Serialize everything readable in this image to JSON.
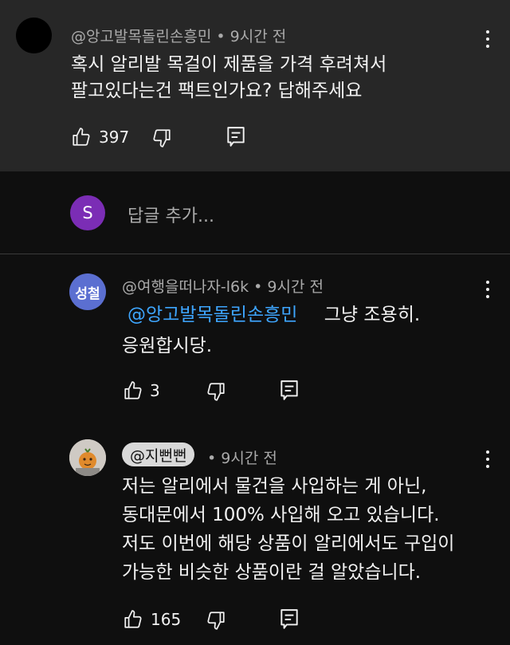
{
  "comment": {
    "author": "@앙고발목돌린손흥민",
    "time": "9시간 전",
    "separator": "•",
    "lines": [
      "혹시 알리발 목걸이 제품을 가격 후려쳐서",
      "팔고있다는건 팩트인가요? 답해주세요"
    ],
    "likes": "397"
  },
  "reply_box": {
    "avatar_letter": "S",
    "placeholder": "답글 추가..."
  },
  "replies": [
    {
      "avatar_text": "성철",
      "author": "@여행을떠나자-l6k",
      "time": "9시간 전",
      "mention": "@앙고발목돌린손흥민",
      "line1_rest": "그냥 조용히.",
      "line2": "응원합시당.",
      "likes": "3"
    },
    {
      "author": "@지뻔뻔",
      "time": "9시간 전",
      "lines": [
        "저는 알리에서 물건을 사입하는 게 아닌,",
        "동대문에서 100% 사입해 오고 있습니다.",
        "저도 이번에 해당 상품이 알리에서도 구입이",
        "가능한 비슷한 상품이란 걸 알았습니다."
      ],
      "likes": "165"
    }
  ],
  "icons": {
    "like": "thumbs-up-icon",
    "dislike": "thumbs-down-icon",
    "reply": "reply-icon",
    "more": "more-vert-icon"
  },
  "colors": {
    "background": "#0f0f0f",
    "highlight": "#272727",
    "mention": "#3ea6ff",
    "avatar_s": "#7b2db5",
    "avatar_blue": "#5b6fd1"
  }
}
